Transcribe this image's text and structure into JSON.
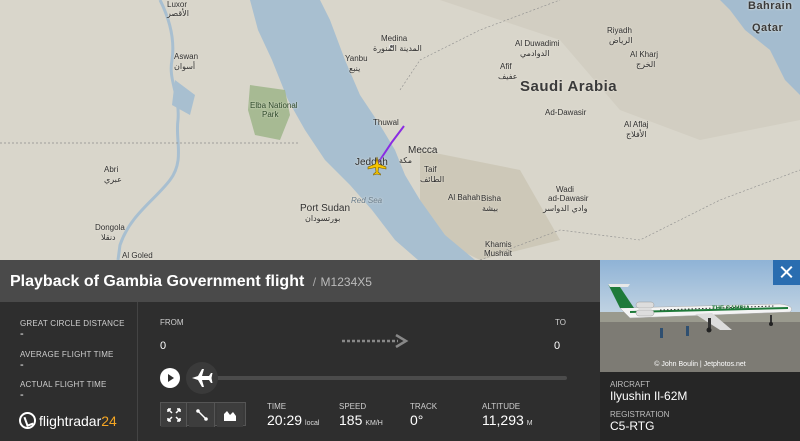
{
  "map": {
    "labels": {
      "bahrain": "Bahrain",
      "qatar": "Qatar",
      "saudi": "Saudi Arabia",
      "luxor": "Luxor",
      "luxor_ar": "الأقصر",
      "aswan": "Aswan",
      "aswan_ar": "أسوان",
      "medina": "Medina",
      "medina_ar": "المدينة المنورة",
      "yanbu": "Yanbu",
      "yanbu_ar": "ينبع",
      "riyadh": "Riyadh",
      "riyadh_ar": "الرياض",
      "al_kharj": "Al Kharj",
      "al_kharj_ar": "الخرج",
      "al_duwadimi": "Al Duwadimi",
      "al_duwadimi_ar": "الدوادمي",
      "afif": "Afif",
      "afif_ar": "عفيف",
      "ad_dawasir": "Ad-Dawasir",
      "al_aflaj": "Al Aflaj",
      "al_aflaj_ar": "الأفلاج",
      "mecca": "Mecca",
      "mecca_ar": "مكة",
      "jeddah": "Jeddah",
      "thuwal": "Thuwal",
      "taif": "Taif",
      "taif_ar": "الطائف",
      "al_baha": "Al Bahah",
      "bisha": "Bisha",
      "bisha_ar": "بيشة",
      "wadi": "Wadi",
      "ad_dawasir_2": "ad-Dawasir",
      "wadi_ar": "وادي الدواسر",
      "khamis": "Khamis",
      "mushait": "Mushait",
      "port_sudan": "Port Sudan",
      "port_sudan_ar": "بورتسودان",
      "red_sea": "Red Sea",
      "elba": "Elba National",
      "park": "Park",
      "abri": "Abri",
      "abri_ar": "عبري",
      "dongola": "Dongola",
      "dongola_ar": "دنقلا",
      "al_goled": "Al Goled"
    }
  },
  "header": {
    "title": "Playback of Gambia Government flight",
    "sep": "/",
    "callsign": "M1234X5"
  },
  "left": {
    "gcd_label": "GREAT CIRCLE DISTANCE",
    "gcd_value": "-",
    "aft_label": "AVERAGE FLIGHT TIME",
    "aft_value": "-",
    "act_label": "ACTUAL FLIGHT TIME",
    "act_value": "-",
    "logo_text": "flightradar",
    "logo_num": "24"
  },
  "route": {
    "from_label": "FROM",
    "from_value": "0",
    "to_label": "TO",
    "to_value": "0"
  },
  "playback": {
    "progress": 0
  },
  "stats": {
    "time_label": "TIME",
    "time_value": "20:29",
    "time_unit": "local",
    "speed_label": "SPEED",
    "speed_value": "185",
    "speed_unit": "KM/H",
    "track_label": "TRACK",
    "track_value": "0°",
    "alt_label": "ALTITUDE",
    "alt_value": "11,293",
    "alt_unit": "M"
  },
  "aircraft": {
    "photo_credit": "© John Boulin | Jetphotos.net",
    "livery": "THE GAMBIA",
    "aircraft_label": "AIRCRAFT",
    "aircraft_value": "Ilyushin Il-62M",
    "reg_label": "REGISTRATION",
    "reg_value": "C5-RTG"
  },
  "colors": {
    "route_line": "#8a2be2",
    "plane": "#f5c400",
    "accent": "#f5a623",
    "close": "#2a6db0"
  }
}
